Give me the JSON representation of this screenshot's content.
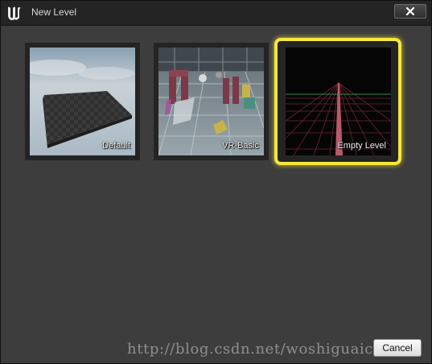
{
  "window": {
    "title": "New Level"
  },
  "templates": [
    {
      "label": "Default",
      "selected": false
    },
    {
      "label": "VR-Basic",
      "selected": false
    },
    {
      "label": "Empty Level",
      "selected": true
    }
  ],
  "footer": {
    "watermark": "http://blog.csdn.net/woshiguaic",
    "cancel_label": "Cancel"
  },
  "colors": {
    "selection": "#f7e73a",
    "background": "#3d3d3d",
    "titlebar": "#242424"
  },
  "icons": {
    "app": "unreal-engine-logo-icon",
    "close": "close-x-icon"
  }
}
